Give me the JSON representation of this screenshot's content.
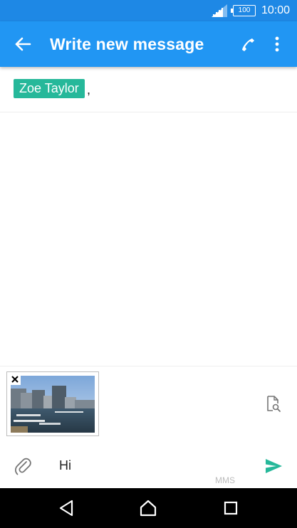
{
  "status_bar": {
    "battery": "100",
    "time": "10:00",
    "signal_icon": "signal-icon",
    "battery_icon": "battery-icon"
  },
  "app_bar": {
    "title": "Write new message",
    "back_icon": "arrow-back-icon",
    "call_icon": "phone-icon",
    "menu_icon": "more-vert-icon",
    "background_color": "#2196F3",
    "status_color": "#1E88E5"
  },
  "recipients": {
    "items": [
      {
        "name": "Zoe Taylor"
      }
    ],
    "separator": ",",
    "chip_color": "#26B89A"
  },
  "attachment": {
    "remove_icon": "close-icon",
    "image_icon": "harbor-photo",
    "preview_icon": "document-search-icon"
  },
  "compose": {
    "attach_icon": "paperclip-icon",
    "message_text": "Hi",
    "message_type": "MMS",
    "send_icon": "send-icon",
    "send_color": "#26B89A"
  },
  "nav_bar": {
    "back_icon": "nav-back-icon",
    "home_icon": "nav-home-icon",
    "recents_icon": "nav-recents-icon"
  }
}
